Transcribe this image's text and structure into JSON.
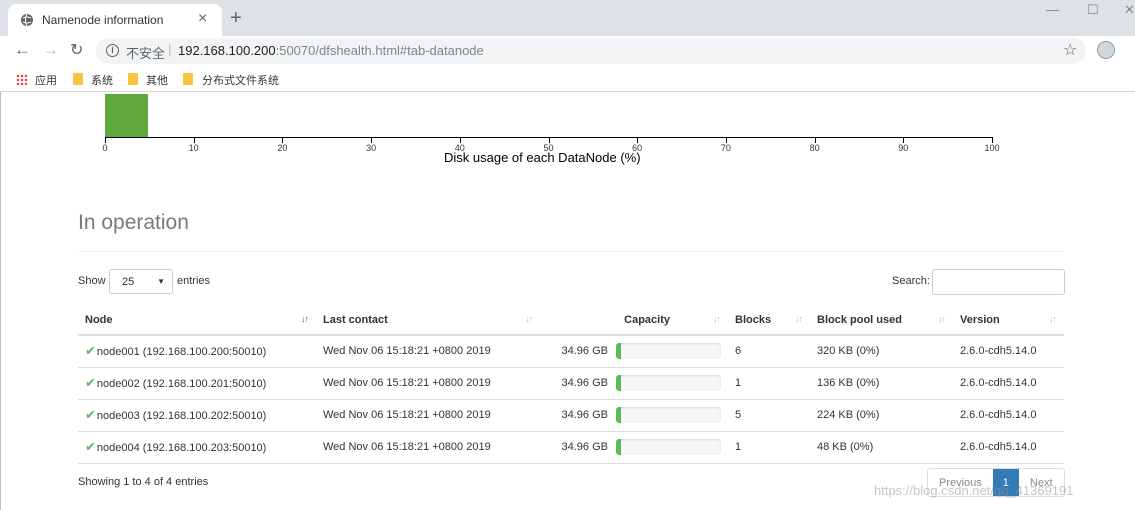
{
  "browser": {
    "tab_title": "Namenode information",
    "insecure_label": "不安全",
    "url_host": "192.168.100.200",
    "url_rest": ":50070/dfshealth.html#tab-datanode",
    "bookmarks": [
      "应用",
      "系统",
      "其他",
      "分布式文件系统"
    ]
  },
  "chart": {
    "axis_title": "Disk usage of each DataNode (%)",
    "ticks": [
      "0",
      "10",
      "20",
      "30",
      "40",
      "50",
      "60",
      "70",
      "80",
      "90",
      "100"
    ]
  },
  "chart_data": {
    "type": "bar",
    "xlabel": "Disk usage of each DataNode (%)",
    "xlim": [
      0,
      100
    ],
    "bins": [
      {
        "range": [
          0,
          5
        ],
        "color": "#5fa83c"
      }
    ]
  },
  "section": {
    "title": "In operation",
    "show_label": "Show",
    "entries_value": "25",
    "entries_label": "entries",
    "search_label": "Search:"
  },
  "table": {
    "headers": [
      "Node",
      "Last contact",
      "Capacity",
      "Blocks",
      "Block pool used",
      "Version"
    ],
    "rows": [
      {
        "node": "node001 (192.168.100.200:50010)",
        "last_contact": "Wed Nov 06 15:18:21 +0800 2019",
        "capacity": "34.96 GB",
        "used_pct": 5,
        "blocks": "6",
        "pool_used": "320 KB (0%)",
        "version": "2.6.0-cdh5.14.0"
      },
      {
        "node": "node002 (192.168.100.201:50010)",
        "last_contact": "Wed Nov 06 15:18:21 +0800 2019",
        "capacity": "34.96 GB",
        "used_pct": 5,
        "blocks": "1",
        "pool_used": "136 KB (0%)",
        "version": "2.6.0-cdh5.14.0"
      },
      {
        "node": "node003 (192.168.100.202:50010)",
        "last_contact": "Wed Nov 06 15:18:21 +0800 2019",
        "capacity": "34.96 GB",
        "used_pct": 5,
        "blocks": "5",
        "pool_used": "224 KB (0%)",
        "version": "2.6.0-cdh5.14.0"
      },
      {
        "node": "node004 (192.168.100.203:50010)",
        "last_contact": "Wed Nov 06 15:18:21 +0800 2019",
        "capacity": "34.96 GB",
        "used_pct": 5,
        "blocks": "1",
        "pool_used": "48 KB (0%)",
        "version": "2.6.0-cdh5.14.0"
      }
    ],
    "info": "Showing 1 to 4 of 4 entries"
  },
  "pagination": {
    "previous": "Previous",
    "current": "1",
    "next": "Next"
  },
  "watermark": "https://blog.csdn.net/qq_41369191"
}
